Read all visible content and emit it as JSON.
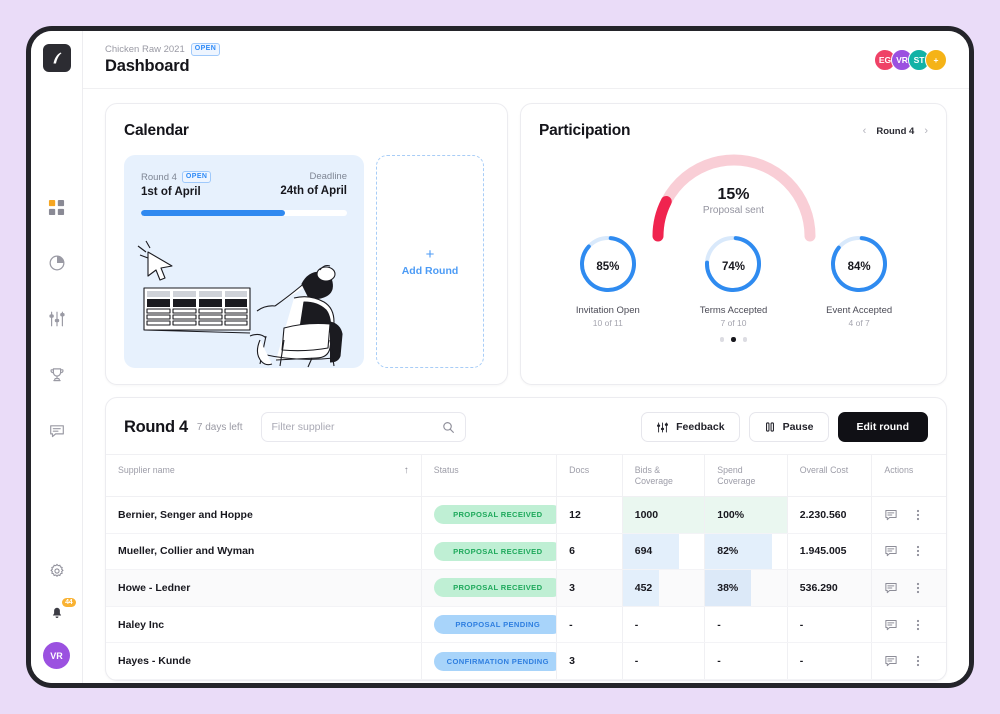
{
  "brand": {
    "logo_icon": "app-logo-icon"
  },
  "topbar": {
    "breadcrumb": "Chicken Raw 2021",
    "breadcrumb_badge": "OPEN",
    "title": "Dashboard",
    "avatars": [
      {
        "initials": "EG",
        "color": "#EF4267"
      },
      {
        "initials": "VR",
        "color": "#9B51E0"
      },
      {
        "initials": "ST",
        "color": "#12B2A6"
      },
      {
        "initials": "+",
        "color": "#F5B317"
      }
    ]
  },
  "sidebar": {
    "items": [
      {
        "name": "dashboard",
        "icon": "grid-icon",
        "active": true
      },
      {
        "name": "analytics",
        "icon": "pie-chart-icon",
        "active": false
      },
      {
        "name": "filters",
        "icon": "sliders-icon",
        "active": false
      },
      {
        "name": "awards",
        "icon": "trophy-icon",
        "active": false
      },
      {
        "name": "messages",
        "icon": "message-icon",
        "active": false
      }
    ],
    "settings_icon": "gear-icon",
    "notifications_icon": "bell-icon",
    "notifications_count": "44",
    "avatar_initials": "VR"
  },
  "calendar": {
    "title": "Calendar",
    "round": {
      "label": "Round 4",
      "badge": "OPEN",
      "start_date": "1st of April",
      "deadline_label": "Deadline",
      "deadline_date": "24th of April",
      "progress_percent": 70
    },
    "add_round": {
      "plus": "+",
      "label": "Add Round"
    }
  },
  "participation": {
    "title": "Participation",
    "round_nav": {
      "prev": "‹",
      "label": "Round 4",
      "next": "›"
    },
    "gauge": {
      "percent": "15%",
      "value": 15,
      "label": "Proposal sent",
      "track_color": "#F9CED6",
      "fill_color": "#F0244F"
    },
    "donuts": [
      {
        "percent": "85%",
        "value": 85,
        "label": "Invitation Open",
        "sub": "10 of 11",
        "color": "#2F8BF0"
      },
      {
        "percent": "74%",
        "value": 74,
        "label": "Terms Accepted",
        "sub": "7 of 10",
        "color": "#2F8BF0"
      },
      {
        "percent": "84%",
        "value": 84,
        "label": "Event Accepted",
        "sub": "4 of 7",
        "color": "#2F8BF0"
      }
    ],
    "pagination": {
      "count": 3,
      "active_index": 1
    }
  },
  "table_section": {
    "title": "Round 4",
    "days_left": "7 days left",
    "search": {
      "placeholder": "Filter supplier",
      "value": "",
      "icon": "search-icon"
    },
    "buttons": [
      {
        "label": "Feedback",
        "icon": "sliders-icon",
        "style": "light"
      },
      {
        "label": "Pause",
        "icon": "pause-icon",
        "style": "light"
      },
      {
        "label": "Edit round",
        "icon": "",
        "style": "dark"
      }
    ],
    "columns": [
      "Supplier name",
      "Status",
      "Docs",
      "Bids & Coverage",
      "Spend Coverage",
      "Overall Cost",
      "Actions"
    ],
    "sort": {
      "column": "Supplier name",
      "direction": "asc",
      "icon": "arrow-up-icon"
    },
    "rows": [
      {
        "supplier": "Bernier, Senger and Hoppe",
        "status": "PROPOSAL RECEIVED",
        "status_style": "green",
        "docs": "12",
        "bids": "1000",
        "bids_bar_percent": 100,
        "bids_bar_style": "green",
        "spend": "100%",
        "spend_bar_percent": 100,
        "spend_bar_style": "green",
        "cost": "2.230.560",
        "hover": false
      },
      {
        "supplier": "Mueller, Collier and Wyman",
        "status": "PROPOSAL RECEIVED",
        "status_style": "green",
        "docs": "6",
        "bids": "694",
        "bids_bar_percent": 69,
        "bids_bar_style": "blue",
        "spend": "82%",
        "spend_bar_percent": 82,
        "spend_bar_style": "blue",
        "cost": "1.945.005",
        "hover": false
      },
      {
        "supplier": "Howe - Ledner",
        "status": "PROPOSAL RECEIVED",
        "status_style": "green",
        "docs": "3",
        "bids": "452",
        "bids_bar_percent": 45,
        "bids_bar_style": "blue",
        "spend": "38%",
        "spend_bar_percent": 56,
        "spend_bar_style": "blue-dk",
        "cost": "536.290",
        "hover": true
      },
      {
        "supplier": "Haley Inc",
        "status": "PROPOSAL PENDING",
        "status_style": "blue",
        "docs": "-",
        "bids": "-",
        "bids_bar_percent": 0,
        "bids_bar_style": "none",
        "spend": "-",
        "spend_bar_percent": 0,
        "spend_bar_style": "none",
        "cost": "-",
        "hover": false
      },
      {
        "supplier": "Hayes - Kunde",
        "status": "CONFIRMATION PENDING",
        "status_style": "blue",
        "docs": "3",
        "bids": "-",
        "bids_bar_percent": 0,
        "bids_bar_style": "none",
        "spend": "-",
        "spend_bar_percent": 0,
        "spend_bar_style": "none",
        "cost": "-",
        "hover": false
      }
    ],
    "row_actions": {
      "comment_icon": "comment-icon",
      "more_icon": "more-vertical-icon"
    }
  }
}
